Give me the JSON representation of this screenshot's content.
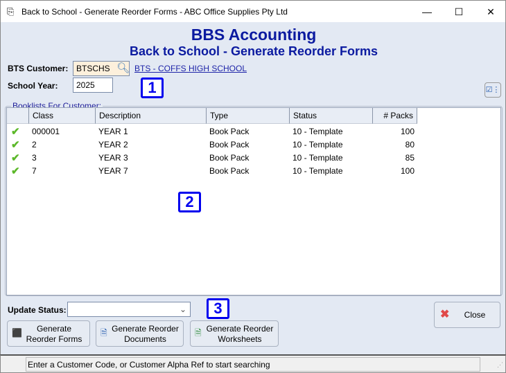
{
  "window": {
    "title": "Back to School - Generate Reorder Forms - ABC Office Supplies Pty Ltd"
  },
  "header": {
    "app": "BBS Accounting",
    "title": "Back to School - Generate Reorder Forms"
  },
  "form": {
    "customer_label": "BTS Customer:",
    "customer_value": "BTSCHS",
    "customer_link": "BTS - COFFS HIGH SCHOOL",
    "year_label": "School Year:",
    "year_value": "2025"
  },
  "badges": [
    "1",
    "2",
    "3"
  ],
  "grid": {
    "legend": "Booklists For Customer:",
    "columns": [
      "Class",
      "Description",
      "Type",
      "Status",
      "# Packs"
    ],
    "rows": [
      {
        "class": "000001",
        "description": "YEAR 1",
        "type": "Book Pack",
        "status": "10 - Template",
        "packs": "100"
      },
      {
        "class": "2",
        "description": "YEAR 2",
        "type": "Book Pack",
        "status": "10 - Template",
        "packs": "80"
      },
      {
        "class": "3",
        "description": "YEAR 3",
        "type": "Book Pack",
        "status": "10 - Template",
        "packs": "85"
      },
      {
        "class": "7",
        "description": "YEAR  7",
        "type": "Book Pack",
        "status": "10 - Template",
        "packs": "100"
      }
    ]
  },
  "bottom": {
    "update_status_label": "Update Status:",
    "update_status_value": "",
    "btn_forms_1": "Generate",
    "btn_forms_2": "Reorder Forms",
    "btn_docs_1": "Generate Reorder",
    "btn_docs_2": "Documents",
    "btn_ws_1": "Generate Reorder",
    "btn_ws_2": "Worksheets",
    "close": "Close"
  },
  "statusbar": {
    "text": "Enter a Customer Code, or Customer Alpha Ref to start searching"
  },
  "colors": {
    "accent": "#0b1aa0",
    "badge": "#0000ee",
    "check": "#5cb82a"
  }
}
